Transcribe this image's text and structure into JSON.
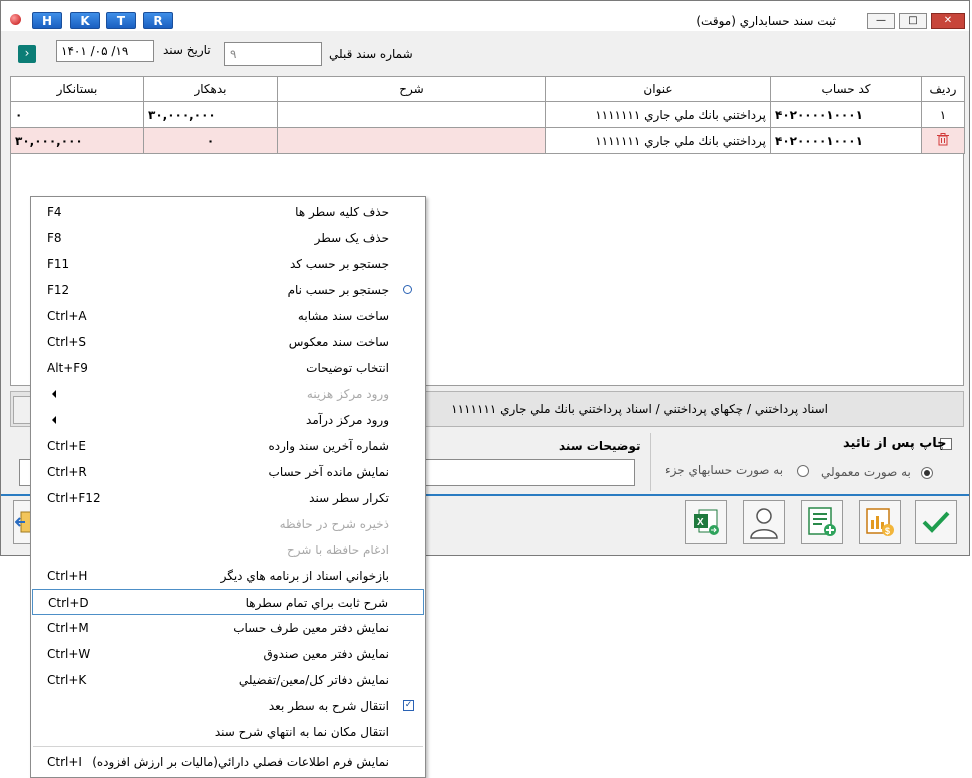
{
  "window": {
    "title": "ثبت سند حسابداري (موقت)",
    "quick_buttons": [
      "H",
      "K",
      "T",
      "R"
    ]
  },
  "header": {
    "prev_doc_label": "شماره سند قبلي",
    "prev_doc_value": "۹",
    "date_label": "تاريخ سند",
    "date_value": "۱۴۰۱ /۰۵ /۱۹"
  },
  "grid": {
    "columns": [
      "رديف",
      "کد حساب",
      "عنوان",
      "شرح",
      "بدهکار",
      "بستانکار"
    ],
    "rows": [
      {
        "row": "۱",
        "code": "۴۰۲۰۰۰۰۱۰۰۰۱",
        "title": "پرداختني بانك ملي جاري ۱۱۱۱۱۱۱",
        "desc": "",
        "debit": "۳۰,۰۰۰,۰۰۰",
        "credit": "۰"
      },
      {
        "row": "",
        "code": "۴۰۲۰۰۰۰۱۰۰۰۱",
        "title": "پرداختني بانك ملي جاري ۱۱۱۱۱۱۱",
        "desc": "",
        "debit": "۰",
        "credit": "۳۰,۰۰۰,۰۰۰"
      }
    ]
  },
  "path_text": "اسناد پرداختني / چکهاي پرداختني / اسناد پرداختني بانك ملي جاري ۱۱۱۱۱۱۱",
  "notes_label": "توضيحات سند",
  "print_after_approve": "چاپ پس از تائيد",
  "radio_normal": "به صورت معمولي",
  "radio_detail": "به صورت حسابهاي جزء",
  "toolbar_icons": [
    "excel-export-icon",
    "user-icon",
    "add-document-icon",
    "report-chart-icon",
    "confirm-check-icon"
  ],
  "menu": [
    {
      "label": "حذف کليه سطر ها",
      "key": "F4",
      "state": "normal"
    },
    {
      "label": "حذف يک سطر",
      "key": "F8",
      "state": "normal"
    },
    {
      "label": "جستجو بر حسب کد",
      "key": "F11",
      "state": "normal"
    },
    {
      "label": "جستجو بر حسب نام",
      "key": "F12",
      "state": "radio"
    },
    {
      "label": "ساخت سند مشابه",
      "key": "Ctrl+A",
      "state": "normal"
    },
    {
      "label": "ساخت سند معکوس",
      "key": "Ctrl+S",
      "state": "normal"
    },
    {
      "label": "انتخاب توضيحات",
      "key": "Alt+F9",
      "state": "normal"
    },
    {
      "label": "ورود مرکز هزينه",
      "key": "",
      "state": "disabled-submenu"
    },
    {
      "label": "ورود مرکز درآمد",
      "key": "",
      "state": "submenu"
    },
    {
      "label": "شماره آخرين سند وارده",
      "key": "Ctrl+E",
      "state": "normal"
    },
    {
      "label": "نمايش مانده آخر حساب",
      "key": "Ctrl+R",
      "state": "normal"
    },
    {
      "label": "تکرار سطر سند",
      "key": "Ctrl+F12",
      "state": "normal"
    },
    {
      "label": "ذخيره شرح در حافظه",
      "key": "",
      "state": "disabled"
    },
    {
      "label": "ادغام حافظه با شرح",
      "key": "",
      "state": "disabled"
    },
    {
      "label": "بازخواني اسناد از برنامه هاي ديگر",
      "key": "Ctrl+H",
      "state": "normal"
    },
    {
      "label": "شرح ثابت براي تمام سطرها",
      "key": "Ctrl+D",
      "state": "highlighted"
    },
    {
      "label": "نمايش دفتر معين طرف حساب",
      "key": "Ctrl+M",
      "state": "normal"
    },
    {
      "label": "نمايش دفتر معين صندوق",
      "key": "Ctrl+W",
      "state": "normal"
    },
    {
      "label": "نمايش دفاتر کل/معين/تفضيلي",
      "key": "Ctrl+K",
      "state": "normal"
    },
    {
      "label": "انتقال شرح به سطر بعد",
      "key": "",
      "state": "checked"
    },
    {
      "label": "انتقال مکان نما به انتهاي شرح سند",
      "key": "",
      "state": "normal"
    },
    {
      "label": "نمايش فرم اطلاعات فصلي دارائي(ماليات بر ارزش افزوده)",
      "key": "Ctrl+I",
      "state": "normal"
    }
  ]
}
